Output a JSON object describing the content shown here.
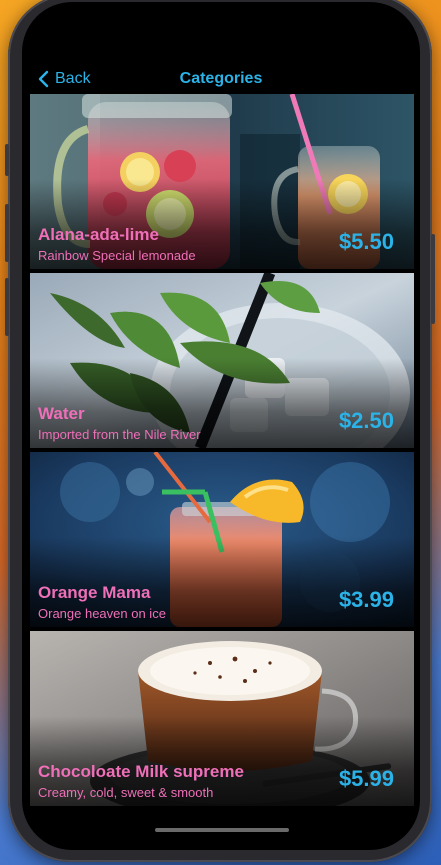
{
  "nav": {
    "back_label": "Back",
    "title": "Categories"
  },
  "items": [
    {
      "name": "Alana-ada-lime",
      "description": "Rainbow Special lemonade",
      "price": "$5.50"
    },
    {
      "name": "Water",
      "description": "Imported from the Nile River",
      "price": "$2.50"
    },
    {
      "name": "Orange Mama",
      "description": "Orange heaven on ice",
      "price": "$3.99"
    },
    {
      "name": "Chocoloate Milk supreme",
      "description": "Creamy, cold, sweet & smooth",
      "price": "$5.99"
    }
  ],
  "colors": {
    "accent": "#2bb3e8",
    "item_text": "#ef6fb8",
    "screen_bg": "#000000"
  }
}
